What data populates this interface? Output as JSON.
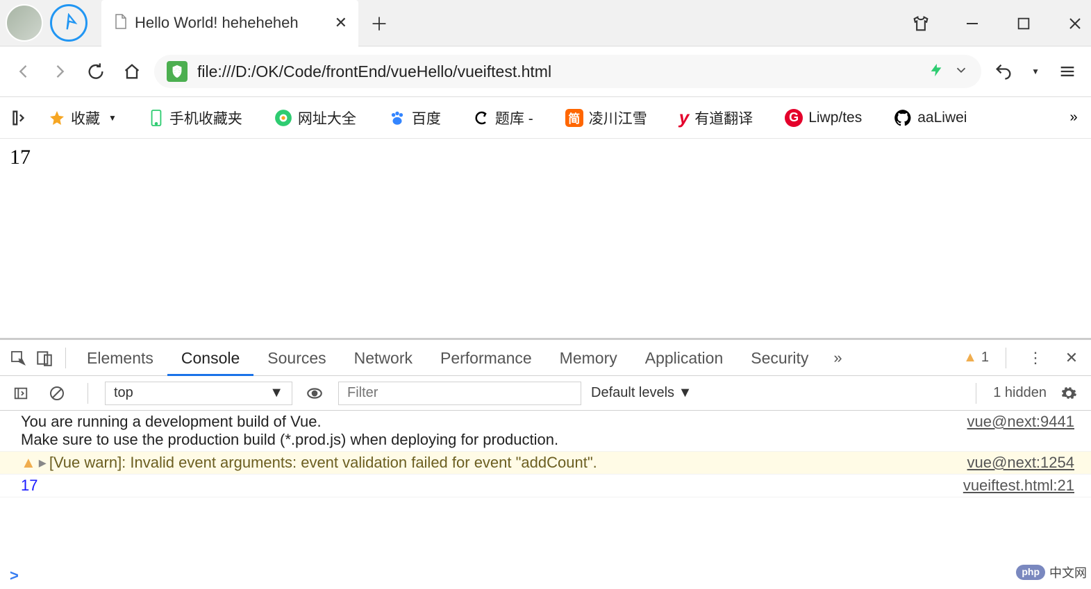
{
  "window": {
    "tab_title": "Hello World! heheheheh",
    "url": "file:///D:/OK/Code/frontEnd/vueHello/vueiftest.html"
  },
  "bookmarks": [
    {
      "label": "收藏",
      "icon": "star",
      "color": "#f6a623",
      "chevron": true
    },
    {
      "label": "手机收藏夹",
      "icon": "phone",
      "color": "#2ecc71"
    },
    {
      "label": "网址大全",
      "icon": "360",
      "color": "#2ecc71"
    },
    {
      "label": "百度",
      "icon": "paw",
      "color": "#3385ff"
    },
    {
      "label": "题库 -",
      "icon": "cswirl",
      "color": "#000"
    },
    {
      "label": "凌川江雪",
      "icon": "jian",
      "color": "#ff6600"
    },
    {
      "label": "有道翻译",
      "icon": "y",
      "color": "#e4002b"
    },
    {
      "label": "Liwp/tes",
      "icon": "g",
      "color": "#e4002b"
    },
    {
      "label": "aaLiwei",
      "icon": "github",
      "color": "#000"
    }
  ],
  "page": {
    "content": "17"
  },
  "devtools": {
    "tabs": [
      "Elements",
      "Console",
      "Sources",
      "Network",
      "Performance",
      "Memory",
      "Application",
      "Security"
    ],
    "active_tab": "Console",
    "more_glyph": "»",
    "warning_count": "1",
    "context": "top",
    "filter_placeholder": "Filter",
    "levels_label": "Default levels ▼",
    "hidden_label": "1 hidden"
  },
  "console": {
    "rows": [
      {
        "kind": "info",
        "text": "You are running a development build of Vue.\nMake sure to use the production build (*.prod.js) when deploying for production.",
        "source": "vue@next:9441"
      },
      {
        "kind": "warn",
        "text": "[Vue warn]: Invalid event arguments: event validation failed for event \"addCount\".",
        "source": "vue@next:1254"
      },
      {
        "kind": "log-num",
        "text": "17",
        "source": "vueiftest.html:21"
      }
    ],
    "prompt": ">"
  },
  "watermark": {
    "badge": "php",
    "text": "中文网"
  }
}
